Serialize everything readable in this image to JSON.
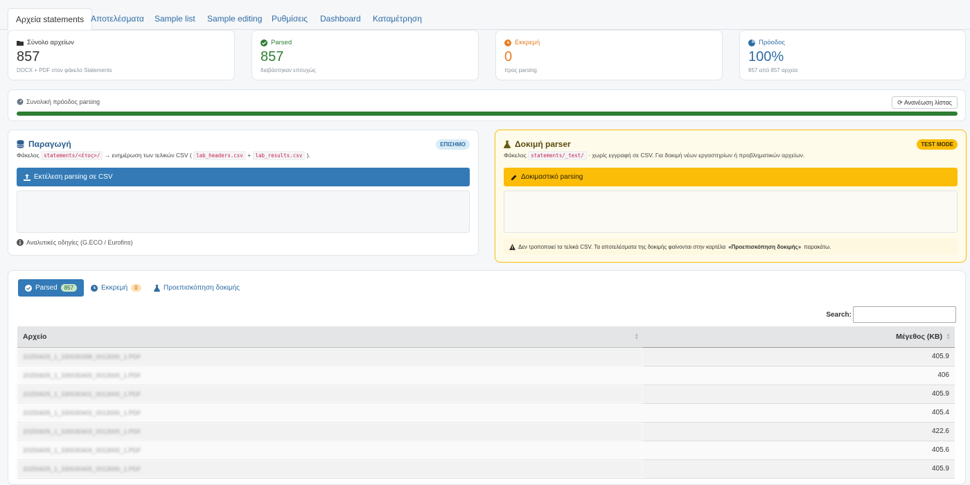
{
  "tabs": [
    "Αρχεία statements",
    "Αποτελέσματα",
    "Sample list",
    "Sample editing",
    "Ρυθμίσεις",
    "Dashboard",
    "Καταμέτρηση"
  ],
  "stats": [
    {
      "label": "Σύνολο αρχείων",
      "value": "857",
      "sub": "DOCX + PDF στον φάκελο Statements",
      "color": "#333333",
      "icon": "folder-icon"
    },
    {
      "label": "Parsed",
      "value": "857",
      "sub": "διαβάστηκαν επιτυχώς",
      "color": "#2e7d32",
      "icon": "check-circle-icon"
    },
    {
      "label": "Εκκρεμή",
      "value": "0",
      "sub": "προς parsing",
      "color": "#e67e22",
      "icon": "clock-icon"
    },
    {
      "label": "Πρόοδος",
      "value": "100%",
      "sub": "857 από 857 αρχεία",
      "color": "#2f6ca5",
      "icon": "pie-chart-icon"
    }
  ],
  "progress": {
    "label": "Συνολική πρόοδος parsing",
    "refresh_label": "Ανανέωση λίστας",
    "fraction": 1.0,
    "color": "#2e7d32"
  },
  "production": {
    "title": "Παραγωγή",
    "badge": "ΕΠΙΣΗΜΟ",
    "desc_prefix": "Φάκελος",
    "folder": "statements/<έτος>/",
    "desc_mid": "→ ενημέρωση των τελικών CSV (",
    "file1": "lab_headers.csv",
    "plus": "+",
    "file2": "lab_results.csv",
    "desc_end": ").",
    "button": "Εκτέλεση parsing σε CSV",
    "note": "Αναλυτικές οδηγίες (G.ECO / Eurofins)"
  },
  "test": {
    "title": "Δοκιμή parser",
    "badge": "TEST MODE",
    "desc_prefix": "Φάκελος",
    "folder": "statements/_test/",
    "desc_rest": "· χωρίς εγγραφή σε CSV. Για δοκιμή νέων εργαστηρίων ή προβληματικών αρχείων.",
    "button": "Δοκιμαστικό parsing",
    "warn_prefix": "Δεν τροποποιεί τα τελικά CSV. Τα αποτελέσματα της δοκιμής φαίνονται στην καρτέλα",
    "warn_bold": "«Προεπισκόπηση δοκιμής»",
    "warn_end": "παρακάτω."
  },
  "subtabs": {
    "parsed": {
      "label": "Parsed",
      "count": "857"
    },
    "pending": {
      "label": "Εκκρεμή",
      "count": "0"
    },
    "preview": {
      "label": "Προεπισκόπηση δοκιμής"
    }
  },
  "search": {
    "label": "Search:",
    "value": ""
  },
  "table": {
    "headers": [
      "Αρχείο",
      "Μέγεθος (KB)"
    ],
    "rows": [
      [
        "20250605_1_330030398_0013000_1.PDF",
        "405.9"
      ],
      [
        "20250605_1_330030400_0013000_1.PDF",
        "406"
      ],
      [
        "20250605_1_330030401_0013000_1.PDF",
        "405.9"
      ],
      [
        "20250605_1_330030402_0013000_1.PDF",
        "405.4"
      ],
      [
        "20250605_1_330030403_0013000_1.PDF",
        "422.6"
      ],
      [
        "20250605_1_330030404_0013000_1.PDF",
        "405.6"
      ],
      [
        "20250605_1_330030405_0013000_1.PDF",
        "405.9"
      ]
    ]
  },
  "colors": {
    "primary": "#337ab7",
    "warning": "#fbbd08",
    "success": "#2e7d32"
  }
}
